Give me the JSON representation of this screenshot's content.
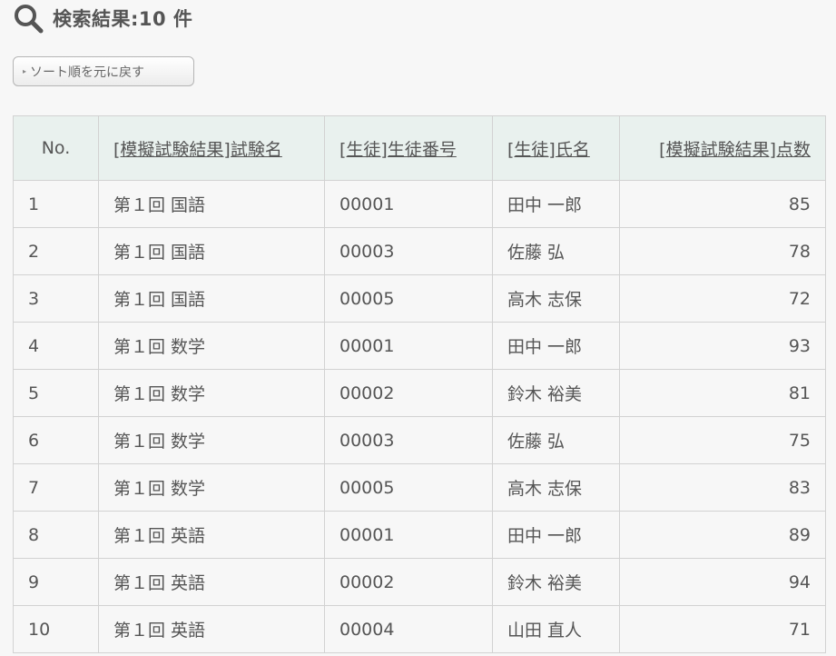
{
  "header": {
    "icon": "search-icon",
    "title": "検索結果:10 件"
  },
  "reset_button": {
    "marker": "▸",
    "label": "ソート順を元に戻す"
  },
  "table": {
    "columns": [
      {
        "label": "No.",
        "sortable": false
      },
      {
        "label": "[模擬試験結果]試験名",
        "sortable": true
      },
      {
        "label": "[生徒]生徒番号",
        "sortable": true
      },
      {
        "label": "[生徒]氏名",
        "sortable": true
      },
      {
        "label": "[模擬試験結果]点数",
        "sortable": true
      }
    ],
    "rows": [
      {
        "no": "1",
        "exam": "第１回 国語",
        "student_id": "00001",
        "name": "田中 一郎",
        "score": "85"
      },
      {
        "no": "2",
        "exam": "第１回 国語",
        "student_id": "00003",
        "name": "佐藤 弘",
        "score": "78"
      },
      {
        "no": "3",
        "exam": "第１回 国語",
        "student_id": "00005",
        "name": "高木 志保",
        "score": "72"
      },
      {
        "no": "4",
        "exam": "第１回 数学",
        "student_id": "00001",
        "name": "田中 一郎",
        "score": "93"
      },
      {
        "no": "5",
        "exam": "第１回 数学",
        "student_id": "00002",
        "name": "鈴木 裕美",
        "score": "81"
      },
      {
        "no": "6",
        "exam": "第１回 数学",
        "student_id": "00003",
        "name": "佐藤 弘",
        "score": "75"
      },
      {
        "no": "7",
        "exam": "第１回 数学",
        "student_id": "00005",
        "name": "高木 志保",
        "score": "83"
      },
      {
        "no": "8",
        "exam": "第１回 英語",
        "student_id": "00001",
        "name": "田中 一郎",
        "score": "89"
      },
      {
        "no": "9",
        "exam": "第１回 英語",
        "student_id": "00002",
        "name": "鈴木 裕美",
        "score": "94"
      },
      {
        "no": "10",
        "exam": "第１回 英語",
        "student_id": "00004",
        "name": "山田 直人",
        "score": "71"
      }
    ]
  },
  "colors": {
    "background": "#f7f7f7",
    "header_row": "#e9f1ee",
    "border": "#d2d2d2",
    "text": "#555555"
  }
}
